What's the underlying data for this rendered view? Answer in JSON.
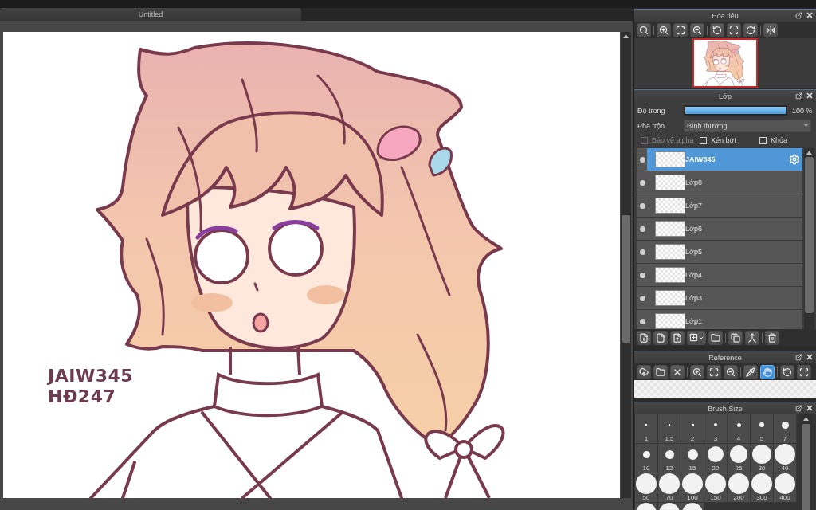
{
  "document_tab": {
    "title": "Untitled"
  },
  "canvas": {
    "signature": [
      "JAIW345",
      "HĐ247"
    ]
  },
  "navigator": {
    "title": "Hoa tiêu"
  },
  "layers": {
    "title": "Lớp",
    "opacity": {
      "label": "Độ trong",
      "level": 1,
      "reading": "100 %"
    },
    "blend": {
      "label": "Pha trộn",
      "value": "Bình thường"
    },
    "options": [
      {
        "label": "Bảo vệ alpha",
        "checked": false,
        "disabled": true
      },
      {
        "label": "Xén bớt",
        "checked": false,
        "disabled": false
      },
      {
        "label": "Khóa",
        "checked": false,
        "disabled": false
      }
    ],
    "items": [
      {
        "name": "JAIW345",
        "selected": true
      },
      {
        "name": "Lớp8",
        "selected": false
      },
      {
        "name": "Lớp7",
        "selected": false
      },
      {
        "name": "Lớp6",
        "selected": false
      },
      {
        "name": "Lớp5",
        "selected": false
      },
      {
        "name": "Lớp4",
        "selected": false
      },
      {
        "name": "Lớp3",
        "selected": false
      },
      {
        "name": "Lớp1",
        "selected": false
      }
    ]
  },
  "reference": {
    "title": "Reference",
    "tools": [
      {
        "kind": "upload",
        "selected": false
      },
      {
        "kind": "folder",
        "selected": false
      },
      {
        "kind": "close",
        "selected": false
      },
      {
        "kind": "zoomin",
        "selected": false
      },
      {
        "kind": "fit",
        "selected": false
      },
      {
        "kind": "zoomout",
        "selected": false
      },
      {
        "kind": "eyedropper",
        "selected": false
      },
      {
        "kind": "hand",
        "selected": true
      },
      {
        "kind": "rotate",
        "selected": false
      },
      {
        "kind": "fullscreen",
        "selected": false
      }
    ]
  },
  "brush_size": {
    "title": "Brush Size",
    "sizes": [
      "1",
      "1.5",
      "2",
      "3",
      "4",
      "5",
      "7",
      "10",
      "12",
      "15",
      "20",
      "25",
      "30",
      "40",
      "50",
      "70",
      "100",
      "150",
      "200",
      "300",
      "400"
    ]
  }
}
